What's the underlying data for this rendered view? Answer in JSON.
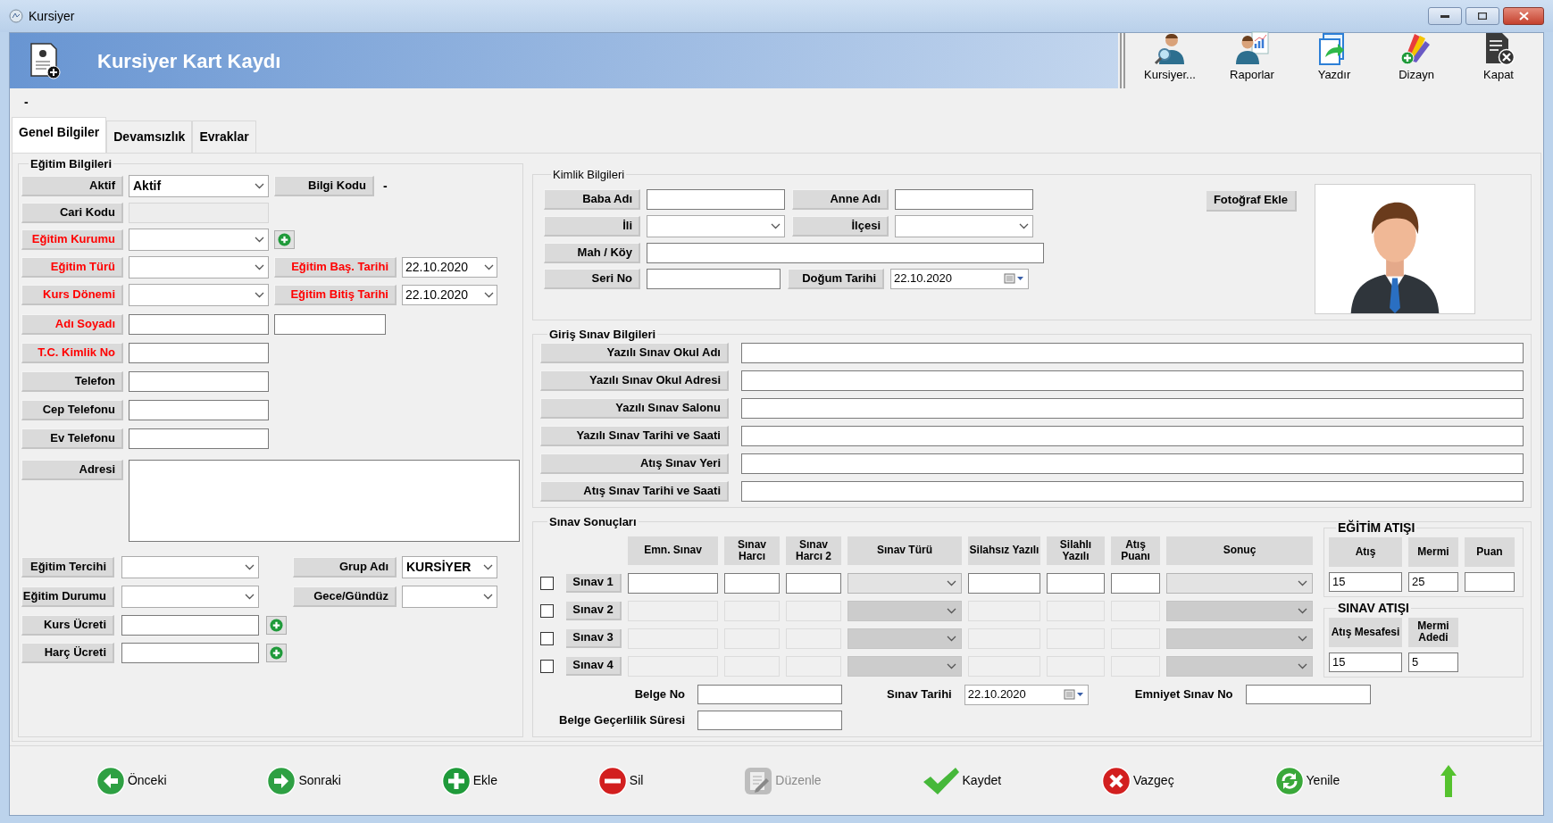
{
  "window": {
    "title": "Kursiyer"
  },
  "header": {
    "title": "Kursiyer Kart Kaydı"
  },
  "toolbar": [
    {
      "kind": "search-person",
      "label": "Kursiyer..."
    },
    {
      "kind": "report",
      "label": "Raporlar"
    },
    {
      "kind": "print",
      "label": "Yazdır"
    },
    {
      "kind": "design",
      "label": "Dizayn"
    },
    {
      "kind": "close",
      "label": "Kapat"
    }
  ],
  "status_text": "-",
  "tabs": [
    {
      "label": "Genel Bilgiler",
      "selected": true
    },
    {
      "label": "Devamsızlık",
      "selected": false
    },
    {
      "label": "Evraklar",
      "selected": false
    }
  ],
  "egitim_bilgileri": {
    "title": "Eğitim Bilgileri",
    "rows": [
      {
        "fields": [
          {
            "label": "Aktif",
            "required": false,
            "kind": "combo",
            "value": "Aktif"
          },
          {
            "label": "Bilgi Kodu",
            "required": false,
            "kind": "plain",
            "value": "-"
          }
        ]
      },
      {
        "fields": [
          {
            "label": "Cari Kodu",
            "required": false,
            "kind": "readonly"
          }
        ]
      },
      {
        "fields": [
          {
            "label": "Eğitim Kurumu",
            "required": true,
            "kind": "combo",
            "add": true
          }
        ]
      },
      {
        "fields": [
          {
            "label": "Eğitim Türü",
            "required": true,
            "kind": "combo"
          },
          {
            "label": "Eğitim Baş. Tarihi",
            "required": true,
            "kind": "date",
            "value": "22.10.2020"
          }
        ]
      },
      {
        "fields": [
          {
            "label": "Kurs Dönemi",
            "required": true,
            "kind": "combo"
          },
          {
            "label": "Eğitim Bitiş Tarihi",
            "required": true,
            "kind": "date",
            "value": "22.10.2020"
          }
        ]
      },
      {
        "fields": [
          {
            "label": "Adı Soyadı",
            "required": true,
            "kind": "text"
          },
          {
            "kind": "text"
          }
        ]
      },
      {
        "fields": [
          {
            "label": "T.C. Kimlik No",
            "required": true,
            "kind": "text"
          }
        ]
      },
      {
        "fields": [
          {
            "label": "Telefon",
            "required": false,
            "kind": "text"
          }
        ]
      },
      {
        "fields": [
          {
            "label": "Cep Telefonu",
            "required": false,
            "kind": "text"
          }
        ]
      },
      {
        "fields": [
          {
            "label": "Ev Telefonu",
            "required": false,
            "kind": "text"
          }
        ]
      },
      {
        "fields": [
          {
            "label": "Adresi",
            "required": false,
            "kind": "textarea"
          }
        ]
      },
      {
        "fields": [
          {
            "label": "Eğitim Tercihi",
            "required": false,
            "kind": "combo"
          },
          {
            "label": "Grup Adı",
            "required": false,
            "kind": "combo",
            "value": "KURSİYER"
          }
        ]
      },
      {
        "fields": [
          {
            "label": "Eğitim Durumu",
            "required": false,
            "kind": "combo"
          },
          {
            "label": "Gece/Gündüz",
            "required": false,
            "kind": "combo"
          }
        ]
      },
      {
        "fields": [
          {
            "label": "Kurs Ücreti",
            "required": false,
            "kind": "text",
            "add": true
          }
        ]
      },
      {
        "fields": [
          {
            "label": "Harç Ücreti",
            "required": false,
            "kind": "text",
            "add": true
          }
        ]
      }
    ]
  },
  "kimlik_bilgileri": {
    "title": "Kimlik Bilgileri",
    "rows": [
      {
        "fields": [
          {
            "label": "Baba Adı",
            "kind": "text"
          },
          {
            "label": "Anne Adı",
            "kind": "text"
          }
        ]
      },
      {
        "fields": [
          {
            "label": "İli",
            "kind": "combo"
          },
          {
            "label": "İlçesi",
            "kind": "combo"
          }
        ]
      },
      {
        "fields": [
          {
            "label": "Mah / Köy",
            "kind": "text"
          }
        ]
      },
      {
        "fields": [
          {
            "label": "Seri No",
            "kind": "text"
          },
          {
            "label": "Doğum Tarihi",
            "kind": "datepicker",
            "value": "22.10.2020"
          }
        ]
      }
    ],
    "photo_button": "Fotoğraf Ekle"
  },
  "giris_sinav_bilgileri": {
    "title": "Giriş Sınav Bilgileri",
    "fields": [
      "Yazılı Sınav Okul Adı",
      "Yazılı Sınav Okul Adresi",
      "Yazılı Sınav Salonu",
      "Yazılı Sınav Tarihi ve Saati",
      "Atış Sınav Yeri",
      "Atış Sınav Tarihi ve Saati"
    ]
  },
  "sinav_sonuclari": {
    "title": "Sınav Sonuçları",
    "columns": [
      {
        "label": "Emn. Sınav",
        "kind": "text"
      },
      {
        "label": "Sınav Harcı",
        "kind": "text"
      },
      {
        "label": "Sınav Harcı 2",
        "kind": "text"
      },
      {
        "label": "Sınav Türü",
        "kind": "combo"
      },
      {
        "label": "Silahsız Yazılı",
        "kind": "text"
      },
      {
        "label": "Silahlı Yazılı",
        "kind": "text"
      },
      {
        "label": "Atış Puanı",
        "kind": "text"
      },
      {
        "label": "Sonuç",
        "kind": "combo"
      }
    ],
    "rows": [
      {
        "label": "Sınav 1",
        "checked": false,
        "disabled": false
      },
      {
        "label": "Sınav 2",
        "checked": false,
        "disabled": true
      },
      {
        "label": "Sınav 3",
        "checked": false,
        "disabled": true
      },
      {
        "label": "Sınav 4",
        "checked": false,
        "disabled": true
      }
    ],
    "egitim_atisi": {
      "title": "EĞİTİM ATIŞI",
      "fields": [
        {
          "label": "Atış",
          "value": "15"
        },
        {
          "label": "Mermi",
          "value": "25"
        },
        {
          "label": "Puan"
        }
      ]
    },
    "sinav_atisi": {
      "title": "SINAV ATIŞI",
      "fields": [
        {
          "label": "Atış Mesafesi",
          "value": "15"
        },
        {
          "label": "Mermi Adedi",
          "value": "5"
        }
      ]
    },
    "belge_no": {
      "label": "Belge No"
    },
    "sinav_tarihi": {
      "label": "Sınav Tarihi",
      "value": "22.10.2020"
    },
    "emniyet_sinav_no": {
      "label": "Emniyet Sınav No"
    },
    "belge_gecerlilik": {
      "label": "Belge Geçerlilik Süresi"
    }
  },
  "actions": [
    {
      "kind": "prev",
      "label": "Önceki",
      "disabled": false
    },
    {
      "kind": "next",
      "label": "Sonraki",
      "disabled": false
    },
    {
      "kind": "add",
      "label": "Ekle",
      "disabled": false
    },
    {
      "kind": "delete",
      "label": "Sil",
      "disabled": false
    },
    {
      "kind": "edit",
      "label": "Düzenle",
      "disabled": true
    },
    {
      "kind": "save",
      "label": "Kaydet",
      "disabled": false
    },
    {
      "kind": "cancel",
      "label": "Vazgeç",
      "disabled": false
    },
    {
      "kind": "refresh",
      "label": "Yenile",
      "disabled": false
    },
    {
      "kind": "up"
    }
  ]
}
